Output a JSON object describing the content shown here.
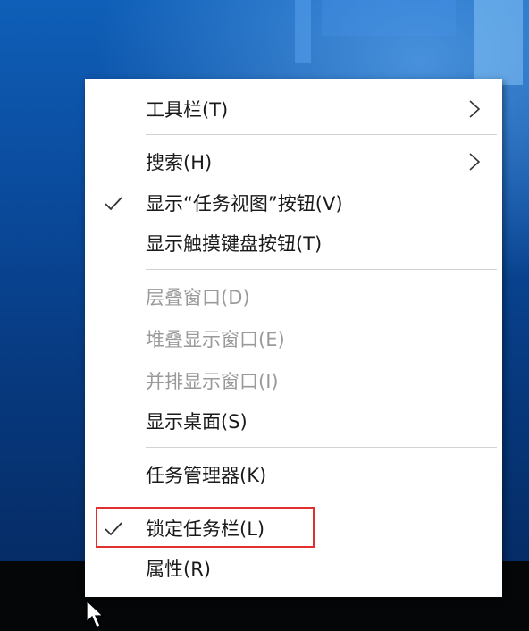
{
  "context_menu": {
    "items": [
      {
        "label": "工具栏(T)",
        "checked": false,
        "submenu": true,
        "disabled": false
      },
      {
        "label": "搜索(H)",
        "checked": false,
        "submenu": true,
        "disabled": false
      },
      {
        "label": "显示“任务视图”按钮(V)",
        "checked": true,
        "submenu": false,
        "disabled": false
      },
      {
        "label": "显示触摸键盘按钮(T)",
        "checked": false,
        "submenu": false,
        "disabled": false
      },
      {
        "label": "层叠窗口(D)",
        "checked": false,
        "submenu": false,
        "disabled": true
      },
      {
        "label": "堆叠显示窗口(E)",
        "checked": false,
        "submenu": false,
        "disabled": true
      },
      {
        "label": "并排显示窗口(I)",
        "checked": false,
        "submenu": false,
        "disabled": true
      },
      {
        "label": "显示桌面(S)",
        "checked": false,
        "submenu": false,
        "disabled": false
      },
      {
        "label": "任务管理器(K)",
        "checked": false,
        "submenu": false,
        "disabled": false
      },
      {
        "label": "锁定任务栏(L)",
        "checked": true,
        "submenu": false,
        "disabled": false,
        "highlighted": true
      },
      {
        "label": "属性(R)",
        "checked": false,
        "submenu": false,
        "disabled": false
      }
    ]
  },
  "colors": {
    "highlight_border": "#e03030",
    "disabled_text": "#9a9a9a",
    "menu_background": "#ffffff"
  },
  "icons": {
    "check": "checkmark-icon",
    "submenu": "chevron-right-icon",
    "cursor": "mouse-pointer-icon"
  }
}
